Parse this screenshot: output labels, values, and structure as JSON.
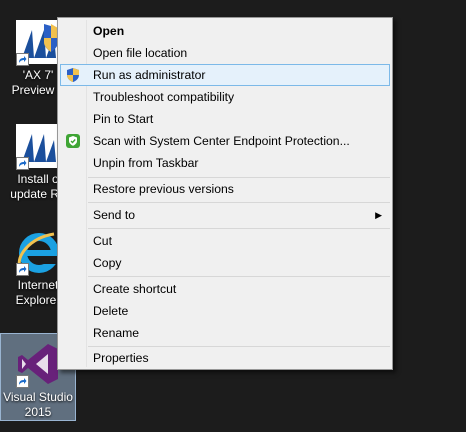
{
  "desktop": {
    "icons": [
      {
        "line1": "'AX 7'",
        "line2": "Preview a",
        "icon": "dynamics-ax-icon"
      },
      {
        "line1": "Install o",
        "line2": "update Re",
        "icon": "dynamics-ax-icon"
      },
      {
        "line1": "Internet",
        "line2": "Explorer",
        "icon": "internet-explorer-icon"
      },
      {
        "line1": "Visual Studio",
        "line2": "2015",
        "icon": "visual-studio-icon"
      }
    ]
  },
  "menu": {
    "items": [
      {
        "label": "Open"
      },
      {
        "label": "Open file location"
      },
      {
        "label": "Run as administrator"
      },
      {
        "label": "Troubleshoot compatibility"
      },
      {
        "label": "Pin to Start"
      },
      {
        "label": "Scan with System Center Endpoint Protection..."
      },
      {
        "label": "Unpin from Taskbar"
      },
      {
        "label": "Restore previous versions"
      },
      {
        "label": "Send to"
      },
      {
        "label": "Cut"
      },
      {
        "label": "Copy"
      },
      {
        "label": "Create shortcut"
      },
      {
        "label": "Delete"
      },
      {
        "label": "Rename"
      },
      {
        "label": "Properties"
      }
    ]
  },
  "colors": {
    "desktop_bg": "#1c1c1c",
    "menu_bg": "#f0f0f0",
    "hover_bg": "#e5f1fb",
    "hover_border": "#7cb9e8",
    "vs_purple": "#68217a",
    "ie_blue": "#1ba1e2",
    "ax_blue": "#1b4f9c"
  }
}
